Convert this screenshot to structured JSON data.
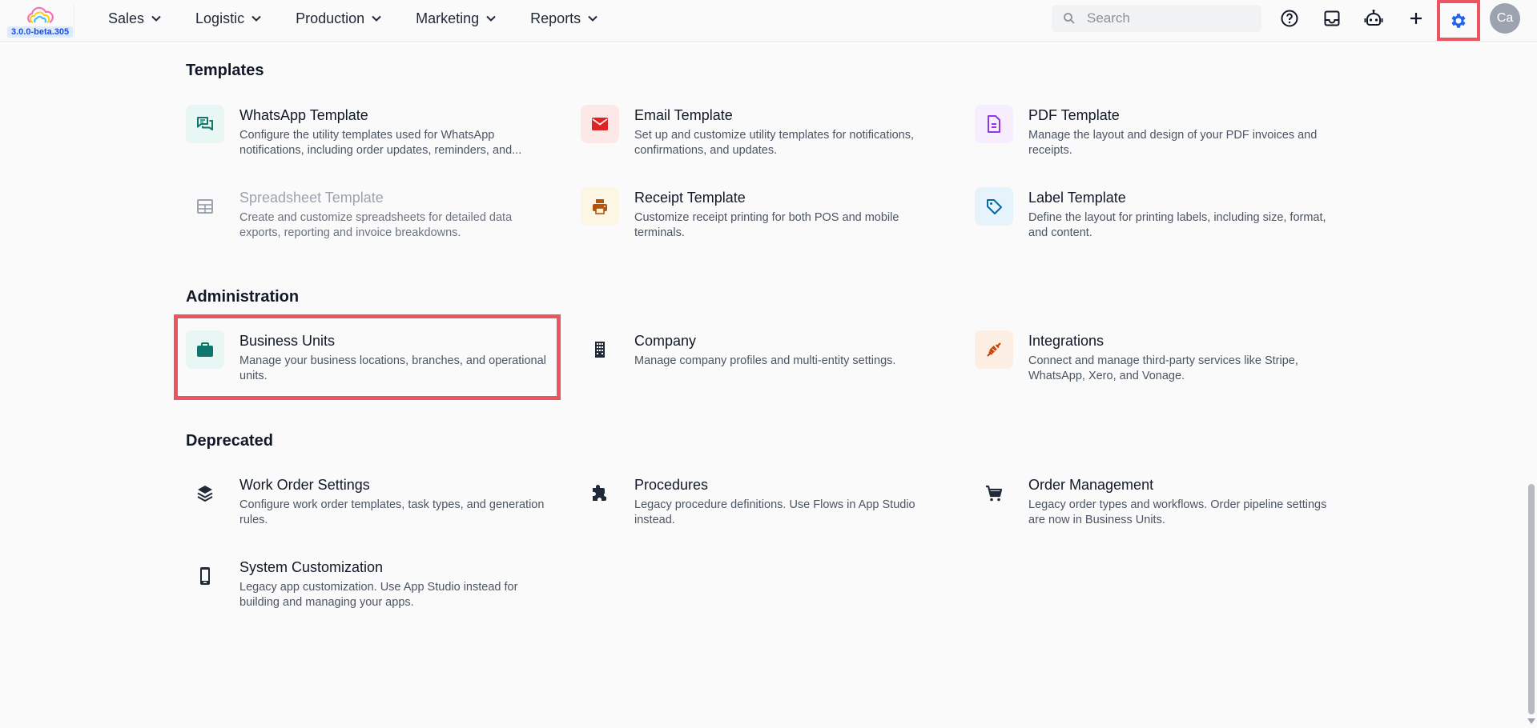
{
  "header": {
    "version": "3.0.0-beta.305",
    "nav": [
      "Sales",
      "Logistic",
      "Production",
      "Marketing",
      "Reports"
    ],
    "search_placeholder": "Search",
    "avatar_initials": "Ca"
  },
  "sections": {
    "templates": {
      "title": "Templates",
      "items": [
        {
          "title": "WhatsApp Template",
          "desc": "Configure the utility templates used for WhatsApp notifications, including order updates, reminders, and...",
          "icon": "chat-icon"
        },
        {
          "title": "Email Template",
          "desc": "Set up and customize utility templates for notifications, confirmations, and updates.",
          "icon": "mail-icon"
        },
        {
          "title": "PDF Template",
          "desc": "Manage the layout and design of your PDF invoices and receipts.",
          "icon": "document-icon"
        },
        {
          "title": "Spreadsheet Template",
          "desc": "Create and customize spreadsheets for detailed data exports, reporting and invoice breakdowns.",
          "icon": "table-icon"
        },
        {
          "title": "Receipt Template",
          "desc": "Customize receipt printing for both POS and mobile terminals.",
          "icon": "printer-icon"
        },
        {
          "title": "Label Template",
          "desc": "Define the layout for printing labels, including size, format, and content.",
          "icon": "tag-icon"
        }
      ]
    },
    "administration": {
      "title": "Administration",
      "items": [
        {
          "title": "Business Units",
          "desc": "Manage your business locations, branches, and operational units.",
          "icon": "briefcase-icon"
        },
        {
          "title": "Company",
          "desc": "Manage company profiles and multi-entity settings.",
          "icon": "building-icon"
        },
        {
          "title": "Integrations",
          "desc": "Connect and manage third-party services like Stripe, WhatsApp, Xero, and Vonage.",
          "icon": "plug-icon"
        }
      ]
    },
    "deprecated": {
      "title": "Deprecated",
      "items": [
        {
          "title": "Work Order Settings",
          "desc": "Configure work order templates, task types, and generation rules.",
          "icon": "layers-icon"
        },
        {
          "title": "Procedures",
          "desc": "Legacy procedure definitions. Use Flows in App Studio instead.",
          "icon": "puzzle-icon"
        },
        {
          "title": "Order Management",
          "desc": "Legacy order types and workflows. Order pipeline settings are now in Business Units.",
          "icon": "cart-icon"
        },
        {
          "title": "System Customization",
          "desc": "Legacy app customization. Use App Studio instead for building and managing your apps.",
          "icon": "phone-icon"
        }
      ]
    }
  },
  "colors": {
    "highlight": "#ec5560",
    "accent": "#2563eb",
    "whatsapp": "#0f766e",
    "email": "#dc2626",
    "pdf": "#9333ea",
    "receipt": "#b45309",
    "label": "#0369a1",
    "integrations": "#c2410c"
  }
}
